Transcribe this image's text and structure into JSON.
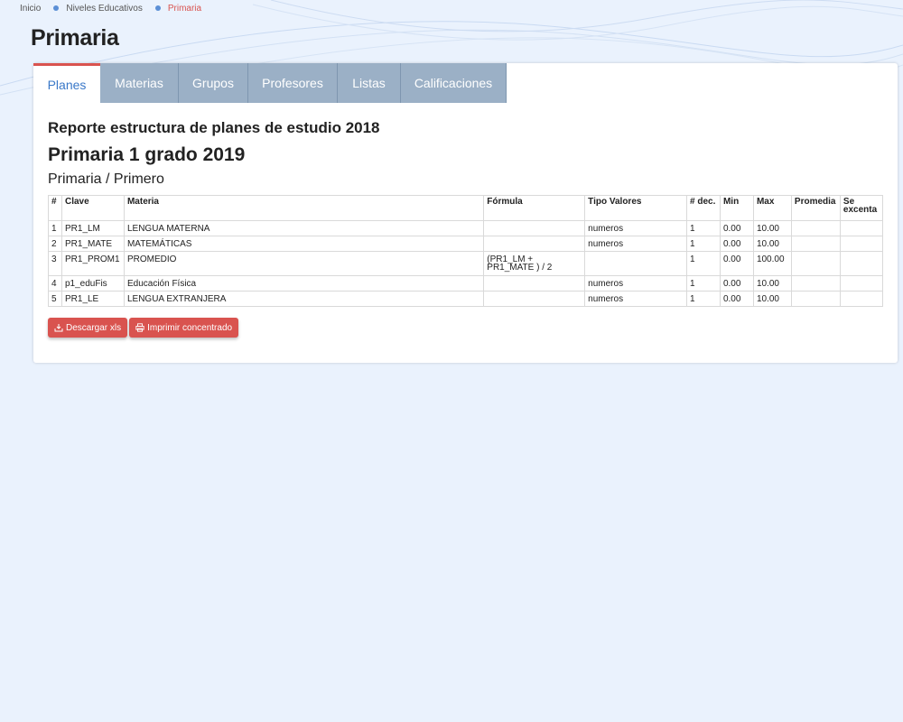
{
  "breadcrumb": {
    "items": [
      "Inicio",
      "Niveles Educativos",
      "Primaria"
    ]
  },
  "page_title": "Primaria",
  "tabs": [
    {
      "label": "Planes",
      "active": true
    },
    {
      "label": "Materias",
      "active": false
    },
    {
      "label": "Grupos",
      "active": false
    },
    {
      "label": "Profesores",
      "active": false
    },
    {
      "label": "Listas",
      "active": false
    },
    {
      "label": "Calificaciones",
      "active": false
    }
  ],
  "report": {
    "title": "Reporte estructura de planes de estudio 2018",
    "plan_title": "Primaria 1 grado 2019",
    "plan_subtitle": "Primaria / Primero"
  },
  "table": {
    "headers": [
      "#",
      "Clave",
      "Materia",
      "Fórmula",
      "Tipo Valores",
      "# dec.",
      "Min",
      "Max",
      "Promedia",
      "Se excenta"
    ],
    "rows": [
      [
        "1",
        "PR1_LM",
        "LENGUA MATERNA",
        "",
        "numeros",
        "1",
        "0.00",
        "10.00",
        "",
        ""
      ],
      [
        "2",
        "PR1_MATE",
        "MATEMÁTICAS",
        "",
        "numeros",
        "1",
        "0.00",
        "10.00",
        "",
        ""
      ],
      [
        "3",
        "PR1_PROM1",
        "PROMEDIO",
        "(PR1_LM + PR1_MATE ) / 2",
        "",
        "1",
        "0.00",
        "100.00",
        "",
        ""
      ],
      [
        "4",
        "p1_eduFis",
        "Educación Física",
        "",
        "numeros",
        "1",
        "0.00",
        "10.00",
        "",
        ""
      ],
      [
        "5",
        "PR1_LE",
        "LENGUA EXTRANJERA",
        "",
        "numeros",
        "1",
        "0.00",
        "10.00",
        "",
        ""
      ]
    ]
  },
  "buttons": {
    "download": "Descargar xls",
    "print": "Imprimir concentrado"
  },
  "colors": {
    "accent": "#d9534f",
    "tab_inactive": "#9bb0c6",
    "tab_active_text": "#3a78c8",
    "background": "#eaf2fd"
  },
  "icons": {
    "download": "download-icon",
    "print": "printer-icon"
  }
}
